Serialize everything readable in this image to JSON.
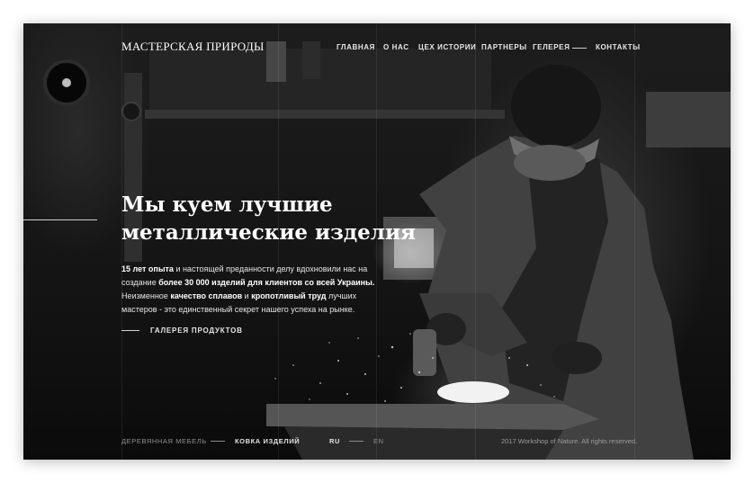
{
  "site": {
    "logo_text": "МАСТЕРСКАЯ ПРИРОДЫ"
  },
  "nav": {
    "items": [
      {
        "label": "ГЛАВНАЯ"
      },
      {
        "label": "О НАС"
      },
      {
        "label": "ЦЕХ ИСТОРИИ"
      },
      {
        "label": "ПАРТНЕРЫ"
      },
      {
        "label": "ГЕЛЕРЕЯ"
      },
      {
        "label": "КОНТАКТЫ"
      }
    ]
  },
  "hero": {
    "headline_line1": "Мы куем лучшие",
    "headline_line2": "металлические изделия",
    "description": {
      "line1_bold": "15 лет опыта",
      "line1_rest": " и настоящей преданности делу вдохновили нас на",
      "line2_start": "создание ",
      "line2_bold": "более 30 000 изделий для клиентов со всей Украины.",
      "line3_start": "Неизменное ",
      "line3_bold1": "качество сплавов",
      "line3_mid": " и ",
      "line3_bold2": "кропотливый труд",
      "line3_end": " лучших",
      "line4": "мастеров - это единственный секрет нашего успеха на рынке."
    },
    "gallery_link": "ГАЛЕРЕЯ ПРОДУКТОВ"
  },
  "footer": {
    "categories": [
      {
        "label": "ДЕРЕВЯННАЯ МЕБЕЛЬ"
      },
      {
        "label": "КОВКА ИЗДЕЛИЙ"
      }
    ],
    "languages": [
      {
        "label": "RU"
      },
      {
        "label": "EN"
      }
    ],
    "copyright": "2017 Workshop of Nature. All rights reserved."
  },
  "colors": {
    "background": "#0e0e0e",
    "text_primary": "#ffffff",
    "text_dim": "#8f8f8f"
  }
}
